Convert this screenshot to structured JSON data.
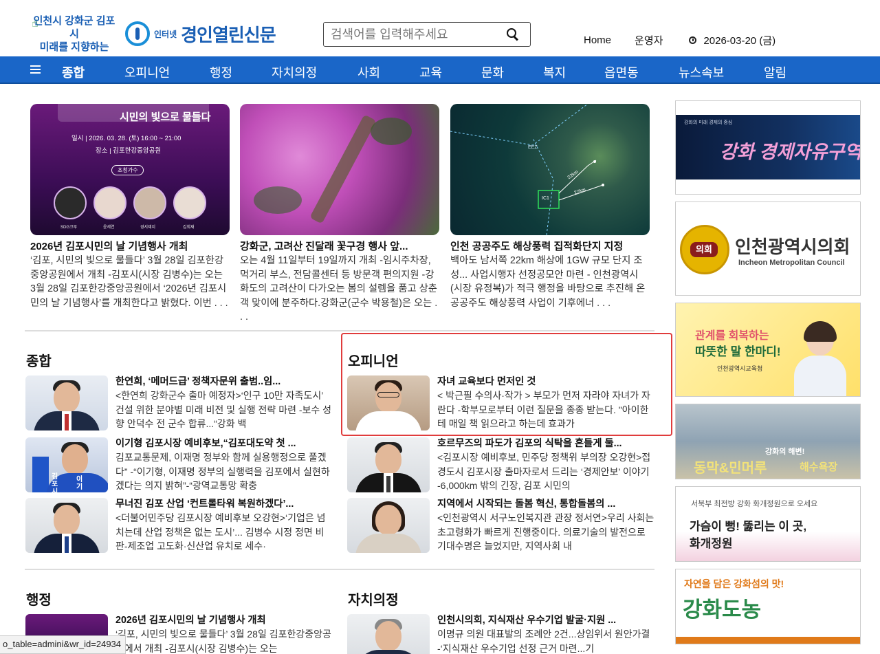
{
  "header": {
    "slogan_line1": "인천시 강화군 김포시",
    "slogan_line2": "미래를 지향하는",
    "logo_small": "인터넷",
    "logo_name": "경인열린신문",
    "search_placeholder": "검색어를 입력해주세요",
    "home": "Home",
    "operator": "운영자",
    "date": "2026-03-20 (금)"
  },
  "nav": {
    "items": [
      "종합",
      "오피니언",
      "행정",
      "자치의정",
      "사회",
      "교육",
      "문화",
      "복지",
      "읍면동",
      "뉴스속보",
      "알림"
    ]
  },
  "cards": [
    {
      "title": "2026년 김포시민의 날 기념행사 개최",
      "desc": "‘김포, 시민의 빛으로 물들다’ 3월 28일 김포한강중앙공원에서 개최 -김포시(시장 김병수)는 오는 3월 28일 김포한강중앙공원에서 ‘2026년 김포시민의 날 기념행사’를 개최한다고 밝혔다. 이번 . . .",
      "img_title": "시민의 빛으로 물들다",
      "img_info1": "일시 | 2026. 03. 28. (토) 16:00 ~ 21:00",
      "img_info2": "장소 | 김포한강중앙공원",
      "img_badge": "초청가수",
      "img_names": [
        "SDG크루",
        "윤세연",
        "경서제지",
        "김희재"
      ]
    },
    {
      "title": "강화군, 고려산 진달래 꽃구경 행사 앞...",
      "desc": "오는 4월 11일부터 19일까지 개최 -임시주차장, 먹거리 부스, 전담콜센터 등 방문객 편의지원 -강화도의 고려산이 다가오는 봄의 설렘을 품고 상춘객 맞이에 분주하다.강화군(군수 박용철)은 오는 . . ."
    },
    {
      "title": "인천 공공주도 해상풍력 집적화단지 지정",
      "desc": "백아도 남서쪽 22km 해상에 1GW 규모 단지 조성... 사업시행자 선정공모안 마련 - 인천광역시(시장 유정복)가 적극 행정을 바탕으로 추진해 온 공공주도 해상풍력 사업이 기후에너 . . .",
      "img_labels": [
        "EEZ",
        "IC1",
        "22km",
        "27km"
      ]
    }
  ],
  "sections": {
    "general": {
      "title": "종합",
      "items": [
        {
          "title": "한연희, ‘메머드급’ 정책자문위 출범..임...",
          "desc": "<한연희 강화군수 출마 예정자>‘인구 10만 자족도시’ 건설 위한 분야별 미래 비전 및 실행 전략 마련 -보수 성향 안덕수 전 군수 합류...“강화 백"
        },
        {
          "title": "이기형 김포시장 예비후보,“김포대도약 첫 ...",
          "desc": "김포교통문제, 이재명 정부와 함께 실용행정으로 풀겠다” -“이기형, 이재명 정부의 실행력을 김포에서 실현하겠다는 의지 밝혀”-“광역교통망 확충",
          "sign_text": "김포시장",
          "sign_text2": "이기"
        },
        {
          "title": "무너진 김포 산업 ‘컨트롤타워 복원하겠다’...",
          "desc": "<더불어민주당 김포시장 예비후보 오강현>‘기업은 넘치는데 산업 정책은 없는 도시’... 김병수 시정 정면 비판-제조업 고도화·신산업 유치로 세수·"
        }
      ]
    },
    "opinion": {
      "title": "오피니언",
      "items": [
        {
          "title": "자녀 교육보다 먼저인 것",
          "desc": "< 박근필 수의사·작가 > 부모가 먼저 자라야 자녀가 자란다 -학부모로부터 이런 질문을 종종 받는다. \"아이한테 매일 책 읽으라고 하는데 효과가"
        },
        {
          "title": "호르무즈의 파도가 김포의 식탁을 흔들게 둘...",
          "desc": "<김포시장 예비후보, 민주당 정책위 부의장 오강현>접경도시 김포시장 출마자로서 드리는 ‘경제안보’ 이야기 -6,000km 밖의 긴장, 김포 시민의"
        },
        {
          "title": "지역에서 시작되는 돌봄 혁신, 통합돌봄의 ...",
          "desc": "<인천광역시 서구노인복지관 관장 정서연>우리 사회는 초고령화가 빠르게 진행중이다. 의료기술의 발전으로 기대수명은 늘었지만, 지역사회 내"
        }
      ]
    },
    "admin": {
      "title": "행정",
      "items": [
        {
          "title": "2026년 김포시민의 날 기념행사 개최",
          "desc": "‘김포, 시민의 빛으로 물들다’ 3월 28일 김포한강중앙공원에서 개최 -김포시(시장 김병수)는 오는"
        }
      ]
    },
    "council": {
      "title": "자치의정",
      "items": [
        {
          "title": "인천시의회, 지식재산 우수기업 발굴·지원 ...",
          "desc": "이명규 의원 대표발의 조례안 2건...상임위서 원안가결 -‘지식재산 우수기업 선정 근거 마련...기"
        }
      ]
    }
  },
  "ads": {
    "ad1_text": "강화 경제자유구역",
    "ad1_small": "강화의 미래 경제의 중심",
    "ad2_seal": "의회",
    "ad2_kor": "인천광역시의회",
    "ad2_eng": "Incheon Metropolitan Council",
    "ad3_line1": "관계를 회복하는",
    "ad3_line2": "따뜻한 말 한마디!",
    "ad3_org": "인천광역시교육청",
    "ad4_small": "강화의 해변!",
    "ad4_big": "동막&민머루",
    "ad4_tail": "해수욕장",
    "ad5_small": "서북부 최전방 강화 화개정원으로 오세요",
    "ad5_line1": "가슴이 뻥! 뚫리는 이 곳,",
    "ad5_line2": "화개정원",
    "ad6_small": "자연을 담은 강화섬의 맛!",
    "ad6_big": "강화도농"
  },
  "status_bar": "o_table=admini&wr_id=24934",
  "colors": {
    "nav_bg": "#1a66c8",
    "brand": "#1a5fb4",
    "highlight": "#e03c3c"
  }
}
